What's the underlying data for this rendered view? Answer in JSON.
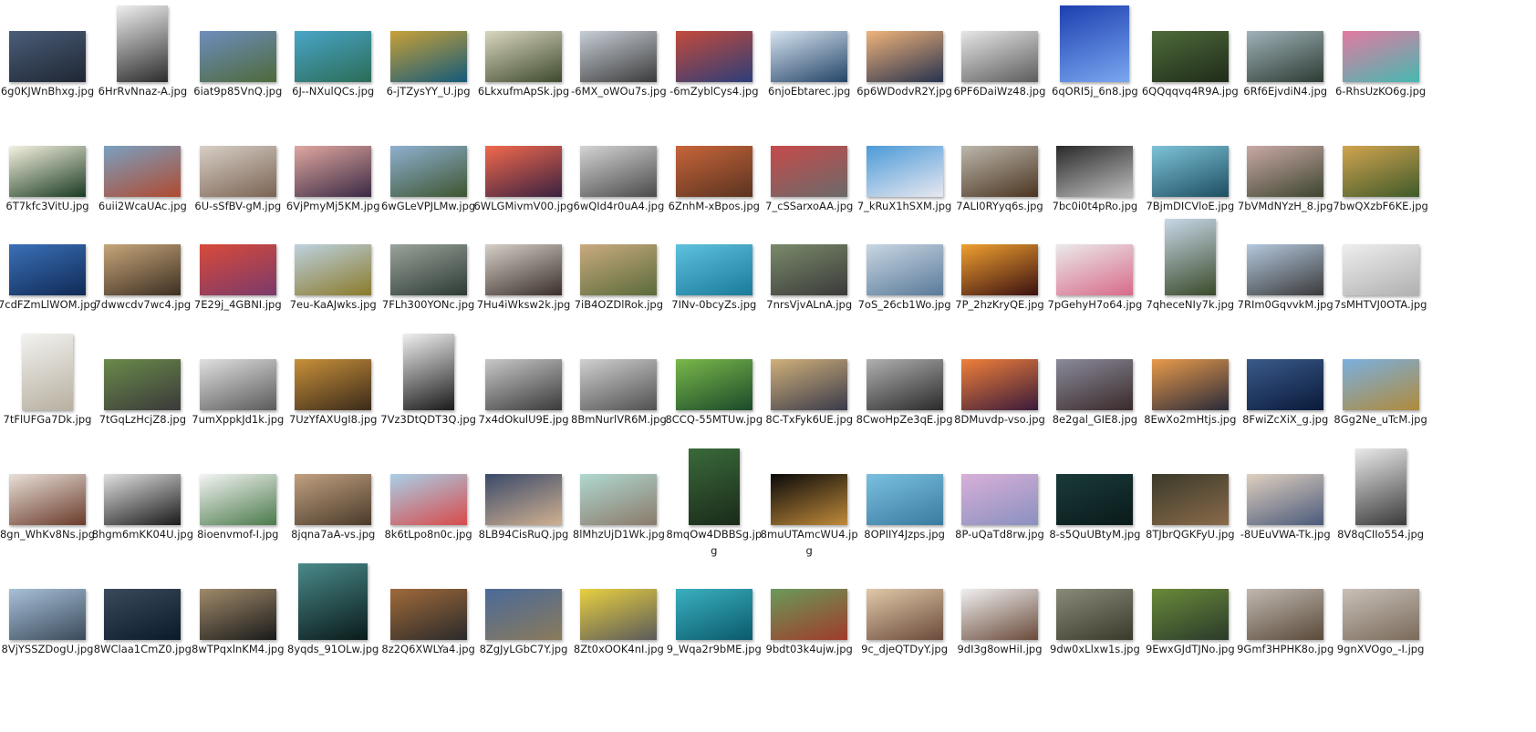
{
  "files": [
    {
      "name": "6g0KJWnBhxg.jpg",
      "c1": "#4a5d78",
      "c2": "#1f2633",
      "o": "l"
    },
    {
      "name": "6HrRvNnaz-A.jpg",
      "c1": "#efefef",
      "c2": "#2c2c2c",
      "o": "p"
    },
    {
      "name": "6iat9p85VnQ.jpg",
      "c1": "#6e8dbd",
      "c2": "#4d6a3a",
      "o": "l"
    },
    {
      "name": "6J--NXulQCs.jpg",
      "c1": "#49a5c8",
      "c2": "#2b6c57",
      "o": "l"
    },
    {
      "name": "6-jTZysYY_U.jpg",
      "c1": "#c8a138",
      "c2": "#145a7a",
      "o": "l"
    },
    {
      "name": "6LkxufmApSk.jpg",
      "c1": "#d9d6bf",
      "c2": "#3e4a2c",
      "o": "l"
    },
    {
      "name": "-6MX_oWOu7s.jpg",
      "c1": "#c7ced6",
      "c2": "#3b3b3b",
      "o": "l"
    },
    {
      "name": "-6mZyblCys4.jpg",
      "c1": "#c44a3a",
      "c2": "#2c3e7a",
      "o": "l"
    },
    {
      "name": "6njoEbtarec.jpg",
      "c1": "#d5e3ef",
      "c2": "#254468",
      "o": "l"
    },
    {
      "name": "6p6WDodvR2Y.jpg",
      "c1": "#f0b37a",
      "c2": "#27324e",
      "o": "l"
    },
    {
      "name": "6PF6DaiWz48.jpg",
      "c1": "#e6e6e6",
      "c2": "#5c5c5c",
      "o": "l"
    },
    {
      "name": "6qORI5j_6n8.jpg",
      "c1": "#1c3fb0",
      "c2": "#7aa7f0",
      "o": "s"
    },
    {
      "name": "6QQqqvq4R9A.jpg",
      "c1": "#4e6b3a",
      "c2": "#1f2b1a",
      "o": "l"
    },
    {
      "name": "6Rf6EjvdiN4.jpg",
      "c1": "#9fb2b8",
      "c2": "#2d3b33",
      "o": "l"
    },
    {
      "name": "6-RhsUzKO6g.jpg",
      "c1": "#e47aa1",
      "c2": "#45b8b0",
      "o": "l"
    },
    {
      "name": "6T7kfc3VitU.jpg",
      "c1": "#f5f2e0",
      "c2": "#1a3a22",
      "o": "l"
    },
    {
      "name": "6uii2WcaUAc.jpg",
      "c1": "#7aa0c0",
      "c2": "#b04a30",
      "o": "l"
    },
    {
      "name": "6U-sSfBV-gM.jpg",
      "c1": "#d8cfc6",
      "c2": "#7a6353",
      "o": "l"
    },
    {
      "name": "6VjPmyMj5KM.jpg",
      "c1": "#e0a7a0",
      "c2": "#3a2a44",
      "o": "l"
    },
    {
      "name": "6wGLeVPJLMw.jpg",
      "c1": "#8fb0d0",
      "c2": "#3d5530",
      "o": "l"
    },
    {
      "name": "6WLGMivmV00.jpg",
      "c1": "#f1694d",
      "c2": "#3a2140",
      "o": "l"
    },
    {
      "name": "6wQId4r0uA4.jpg",
      "c1": "#d4d4d4",
      "c2": "#4a4a4a",
      "o": "l"
    },
    {
      "name": "6ZnhM-xBpos.jpg",
      "c1": "#c7653a",
      "c2": "#5a3320",
      "o": "l"
    },
    {
      "name": "7_cSSarxoAA.jpg",
      "c1": "#c74a4a",
      "c2": "#6a6a6a",
      "o": "l"
    },
    {
      "name": "7_kRuX1hSXM.jpg",
      "c1": "#4b9ad8",
      "c2": "#e8e8f0",
      "o": "l"
    },
    {
      "name": "7ALI0RYyq6s.jpg",
      "c1": "#bdb7ac",
      "c2": "#4a3420",
      "o": "l"
    },
    {
      "name": "7bc0i0t4pRo.jpg",
      "c1": "#2a2a2a",
      "c2": "#bfbfbf",
      "o": "l"
    },
    {
      "name": "7BjmDICVloE.jpg",
      "c1": "#7ec3d8",
      "c2": "#1d4e62",
      "o": "l"
    },
    {
      "name": "7bVMdNYzH_8.jpg",
      "c1": "#c9a9a5",
      "c2": "#3d4530",
      "o": "l"
    },
    {
      "name": "7bwQXzbF6KE.jpg",
      "c1": "#d1a44f",
      "c2": "#3f5a2a",
      "o": "l"
    },
    {
      "name": "7cdFZmLlWOM.jpg",
      "c1": "#3b70b8",
      "c2": "#0f2a55",
      "o": "l"
    },
    {
      "name": "7dwwcdv7wc4.jpg",
      "c1": "#c6a67a",
      "c2": "#3d2f22",
      "o": "l"
    },
    {
      "name": "7E29j_4GBNI.jpg",
      "c1": "#d84a3a",
      "c2": "#7a3a6a",
      "o": "l"
    },
    {
      "name": "7eu-KaAJwks.jpg",
      "c1": "#bdd2e0",
      "c2": "#8a7a2a",
      "o": "l"
    },
    {
      "name": "7FLh300YONc.jpg",
      "c1": "#9aa39c",
      "c2": "#2c3a33",
      "o": "l"
    },
    {
      "name": "7Hu4iWksw2k.jpg",
      "c1": "#d6cfc8",
      "c2": "#3a2f2a",
      "o": "l"
    },
    {
      "name": "7iB4OZDlRok.jpg",
      "c1": "#c9ab7f",
      "c2": "#5a6a3a",
      "o": "l"
    },
    {
      "name": "7INv-0bcyZs.jpg",
      "c1": "#5ec1de",
      "c2": "#1a7a9a",
      "o": "l"
    },
    {
      "name": "7nrsVjvALnA.jpg",
      "c1": "#7a8a6a",
      "c2": "#3a3a3a",
      "o": "l"
    },
    {
      "name": "7oS_26cb1Wo.jpg",
      "c1": "#c8d6e2",
      "c2": "#5a7a9a",
      "o": "l"
    },
    {
      "name": "7P_2hzKryQE.jpg",
      "c1": "#f0a030",
      "c2": "#3a1010",
      "o": "l"
    },
    {
      "name": "7pGehyH7o64.jpg",
      "c1": "#eaeaea",
      "c2": "#d86a8a",
      "o": "l"
    },
    {
      "name": "7qheceNIy7k.jpg",
      "c1": "#c8d8e8",
      "c2": "#3a4a2a",
      "o": "p"
    },
    {
      "name": "7RIm0GqvvkM.jpg",
      "c1": "#b4c8de",
      "c2": "#3a3a3a",
      "o": "l"
    },
    {
      "name": "7sMHTVJ0OTA.jpg",
      "c1": "#eeeeee",
      "c2": "#b0b0b0",
      "o": "l"
    },
    {
      "name": "7tFlUFGa7Dk.jpg",
      "c1": "#f2f2f0",
      "c2": "#b8b0a0",
      "o": "p"
    },
    {
      "name": "7tGqLzHcjZ8.jpg",
      "c1": "#6a8a4a",
      "c2": "#3a3a3a",
      "o": "l"
    },
    {
      "name": "7umXppkJd1k.jpg",
      "c1": "#e0e0e0",
      "c2": "#5a5a5a",
      "o": "l"
    },
    {
      "name": "7UzYfAXUgI8.jpg",
      "c1": "#c8903a",
      "c2": "#3a2a1a",
      "o": "l"
    },
    {
      "name": "7Vz3DtQDT3Q.jpg",
      "c1": "#f0f0f0",
      "c2": "#1a1a1a",
      "o": "p"
    },
    {
      "name": "7x4dOkulU9E.jpg",
      "c1": "#c8c8c8",
      "c2": "#3a3a3a",
      "o": "l"
    },
    {
      "name": "8BmNurlVR6M.jpg",
      "c1": "#d0d0d0",
      "c2": "#505050",
      "o": "l"
    },
    {
      "name": "8CCQ-55MTUw.jpg",
      "c1": "#7ab84a",
      "c2": "#1a4a2a",
      "o": "l"
    },
    {
      "name": "8C-TxFyk6UE.jpg",
      "c1": "#d0b07a",
      "c2": "#3a3a4a",
      "o": "l"
    },
    {
      "name": "8CwoHpZe3qE.jpg",
      "c1": "#b0b0b0",
      "c2": "#2a2a2a",
      "o": "l"
    },
    {
      "name": "8DMuvdp-vso.jpg",
      "c1": "#f0803a",
      "c2": "#3a1a3a",
      "o": "l"
    },
    {
      "name": "8e2gal_GIE8.jpg",
      "c1": "#8a8a9a",
      "c2": "#3a2a2a",
      "o": "l"
    },
    {
      "name": "8EwXo2mHtjs.jpg",
      "c1": "#e89a4a",
      "c2": "#2a2a3a",
      "o": "l"
    },
    {
      "name": "8FwiZcXiX_g.jpg",
      "c1": "#3a5a8a",
      "c2": "#0a1a3a",
      "o": "l"
    },
    {
      "name": "8Gg2Ne_uTcM.jpg",
      "c1": "#7ab0e0",
      "c2": "#b08a3a",
      "o": "l"
    },
    {
      "name": "8gn_WhKv8Ns.jpg",
      "c1": "#e8e0d8",
      "c2": "#6a3a2a",
      "o": "l"
    },
    {
      "name": "8hgm6mKK04U.jpg",
      "c1": "#e0e0e0",
      "c2": "#1a1a1a",
      "o": "l"
    },
    {
      "name": "8ioenvmof-I.jpg",
      "c1": "#f4f4f4",
      "c2": "#4a7a4a",
      "o": "l"
    },
    {
      "name": "8jqna7aA-vs.jpg",
      "c1": "#c0a080",
      "c2": "#4a3a2a",
      "o": "l"
    },
    {
      "name": "8k6tLpo8n0c.jpg",
      "c1": "#a8d0e8",
      "c2": "#d84a4a",
      "o": "l"
    },
    {
      "name": "8LB94CisRuQ.jpg",
      "c1": "#3a4a6a",
      "c2": "#d0b090",
      "o": "l"
    },
    {
      "name": "8lMhzUjD1Wk.jpg",
      "c1": "#b0d8d0",
      "c2": "#8a7a6a",
      "o": "l"
    },
    {
      "name": "8mqOw4DBBSg.jpg",
      "c1": "#3a6a3a",
      "c2": "#1a2a1a",
      "o": "p"
    },
    {
      "name": "8muUTAmcWU4.jpg",
      "c1": "#0a0a0a",
      "c2": "#c08a3a",
      "o": "l"
    },
    {
      "name": "8OPIIY4Jzps.jpg",
      "c1": "#7ac0e0",
      "c2": "#3a7aa0",
      "o": "l"
    },
    {
      "name": "8P-uQaTd8rw.jpg",
      "c1": "#d8b0d8",
      "c2": "#8a90c0",
      "o": "l"
    },
    {
      "name": "8-s5QuUBtyM.jpg",
      "c1": "#1a3a3a",
      "c2": "#0a1a1a",
      "o": "l"
    },
    {
      "name": "8TJbrQGKFyU.jpg",
      "c1": "#3a3a2a",
      "c2": "#8a6a4a",
      "o": "l"
    },
    {
      "name": "-8UEuVWA-Tk.jpg",
      "c1": "#e0d0c0",
      "c2": "#4a5a7a",
      "o": "l"
    },
    {
      "name": "8V8qCIIo554.jpg",
      "c1": "#eaeaea",
      "c2": "#3a3a3a",
      "o": "p"
    },
    {
      "name": "8VjYSSZDogU.jpg",
      "c1": "#a8c0d8",
      "c2": "#3a4a5a",
      "o": "l"
    },
    {
      "name": "8WClaa1CmZ0.jpg",
      "c1": "#3a4a5a",
      "c2": "#0a1a2a",
      "o": "l"
    },
    {
      "name": "8wTPqxlnKM4.jpg",
      "c1": "#a08a6a",
      "c2": "#1a1a1a",
      "o": "l"
    },
    {
      "name": "8yqds_91OLw.jpg",
      "c1": "#4a8a8a",
      "c2": "#0a1a1a",
      "o": "s"
    },
    {
      "name": "8z2Q6XWLYa4.jpg",
      "c1": "#a06a3a",
      "c2": "#2a2a2a",
      "o": "l"
    },
    {
      "name": "8ZgJyLGbC7Y.jpg",
      "c1": "#4a6a9a",
      "c2": "#8a7a5a",
      "o": "l"
    },
    {
      "name": "8Zt0xOOK4nI.jpg",
      "c1": "#e8d040",
      "c2": "#5a5a5a",
      "o": "l"
    },
    {
      "name": "9_Wqa2r9bME.jpg",
      "c1": "#3ab0c0",
      "c2": "#0a5a6a",
      "o": "l"
    },
    {
      "name": "9bdt03k4ujw.jpg",
      "c1": "#6a9a5a",
      "c2": "#a03a2a",
      "o": "l"
    },
    {
      "name": "9c_djeQTDyY.jpg",
      "c1": "#e0c8a8",
      "c2": "#6a4a3a",
      "o": "l"
    },
    {
      "name": "9dI3g8owHiI.jpg",
      "c1": "#f0f0f0",
      "c2": "#6a4a3a",
      "o": "l"
    },
    {
      "name": "9dw0xLlxw1s.jpg",
      "c1": "#8a8a7a",
      "c2": "#3a3a2a",
      "o": "l"
    },
    {
      "name": "9EwxGJdTJNo.jpg",
      "c1": "#6a8a3a",
      "c2": "#2a3a2a",
      "o": "l"
    },
    {
      "name": "9Gmf3HPHK8o.jpg",
      "c1": "#c0b8b0",
      "c2": "#5a4a3a",
      "o": "l"
    },
    {
      "name": "9gnXVOgo_-I.jpg",
      "c1": "#c8c0b8",
      "c2": "#7a6a5a",
      "o": "l"
    }
  ]
}
